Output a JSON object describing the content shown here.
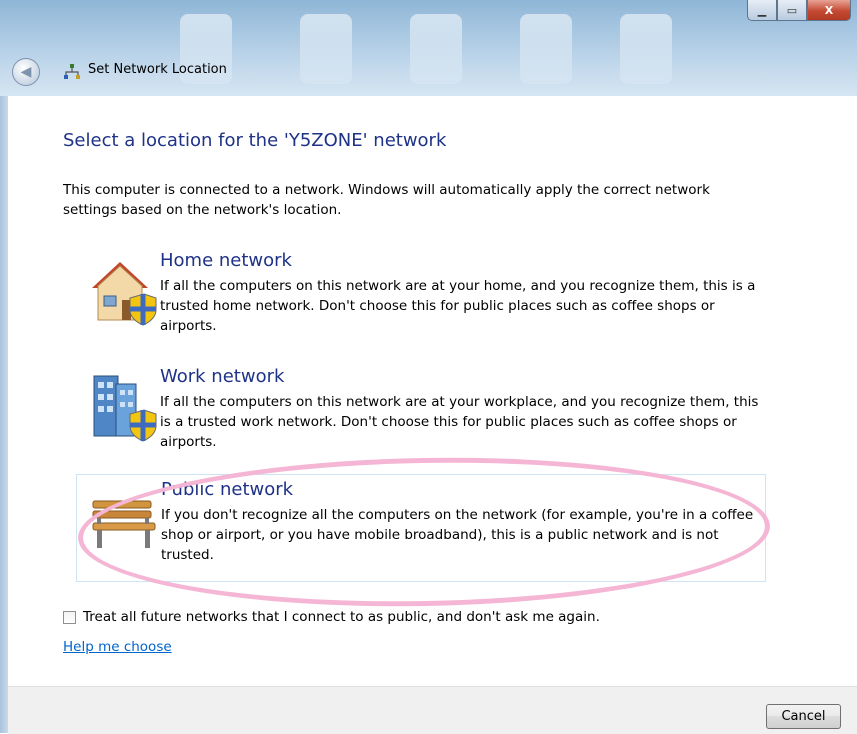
{
  "window": {
    "title": "Set Network Location",
    "controls": {
      "minimize": "▁",
      "maximize": "▭",
      "close": "X"
    }
  },
  "heading": "Select a location for the 'Y5ZONE' network",
  "intro": "This computer is connected to a network. Windows will automatically apply the correct network settings based on the network's location.",
  "options": [
    {
      "title": "Home network",
      "icon": "home-network-icon",
      "description": "If all the computers on this network are at your home, and you recognize them, this is a trusted home network.  Don't choose this for public places such as coffee shops or airports."
    },
    {
      "title": "Work network",
      "icon": "work-network-icon",
      "description": "If all the computers on this network are at your workplace, and you recognize them, this is a trusted work network.  Don't choose this for public places such as coffee shops or airports."
    },
    {
      "title": "Public network",
      "icon": "public-network-icon",
      "description": "If you don't recognize all the computers on the network (for example, you're in a coffee shop or airport, or you have mobile broadband), this is a public network and is not trusted."
    }
  ],
  "checkbox": {
    "label": "Treat all future networks that I connect to as public, and don't ask me again.",
    "checked": false
  },
  "help_link": "Help me choose",
  "buttons": {
    "cancel": "Cancel"
  },
  "colors": {
    "heading": "#1e3287",
    "link": "#0066cc",
    "highlight": "#f4b6d4"
  }
}
